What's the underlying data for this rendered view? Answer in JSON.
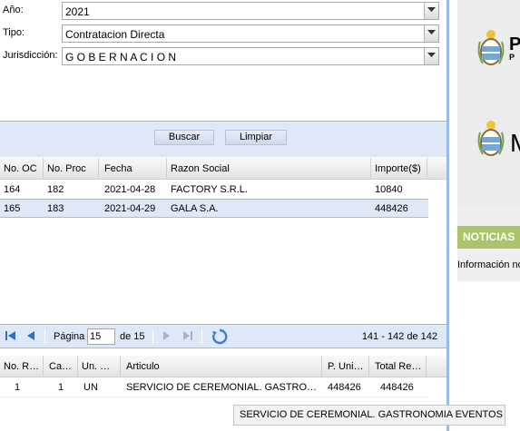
{
  "form": {
    "anio": {
      "label": "Año:",
      "value": "2021"
    },
    "tipo": {
      "label": "Tipo:",
      "value": "Contratacion Directa"
    },
    "jurisdiccion": {
      "label": "Jurisdicción:",
      "value": "G O B E R N A C I O N"
    }
  },
  "buttons": {
    "buscar": "Buscar",
    "limpiar": "Limpiar"
  },
  "orders_grid": {
    "columns": [
      "No. OC",
      "No. Proc",
      "Fecha",
      "Razon Social",
      "Importe($)"
    ],
    "rows": [
      {
        "oc": "164",
        "proc": "182",
        "fecha": "2021-04-28",
        "razon": "FACTORY S.R.L.",
        "importe": "10840"
      },
      {
        "oc": "165",
        "proc": "183",
        "fecha": "2021-04-29",
        "razon": "GALA S.A.",
        "importe": "448426"
      }
    ]
  },
  "pager": {
    "page_label": "Página",
    "page_value": "15",
    "of_label": "de 15",
    "range": "141 - 142 de 142"
  },
  "items_grid": {
    "columns": [
      "No. R…",
      "Ca…",
      "Un. …",
      "Articulo",
      "P. Uni…",
      "Total Re…"
    ],
    "rows": [
      {
        "nr": "1",
        "ca": "1",
        "un": "UN",
        "articulo": "SERVICIO DE CEREMONIAL. GASTRO…",
        "puni": "448426",
        "total": "448426"
      }
    ]
  },
  "right_panel": {
    "logo_text_1": "P",
    "logo_subtext_1": "P",
    "logo_text_2": "M",
    "news_title": "NOTICIAS",
    "news_text": "Información no"
  },
  "tooltip": {
    "text": "SERVICIO DE CEREMONIAL. GASTRONOMIA EVENTOS"
  },
  "colors": {
    "panel_bg": "#dfe8f6",
    "border": "#99bbe8",
    "news_green": "#a9c46a",
    "selected_row": "#dfe8f6"
  }
}
